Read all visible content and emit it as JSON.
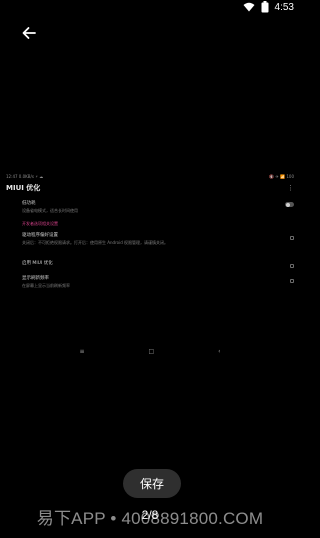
{
  "status_bar": {
    "time": "4:53",
    "icons": [
      "wifi-icon",
      "battery-icon"
    ]
  },
  "nav": {
    "back_icon": "arrow-left-icon"
  },
  "preview": {
    "status_left": "12:47 0.0KB/s ⚡ ☁",
    "status_right": "🔇 ✈ 📶 100",
    "title": "MIUI 优化",
    "menu_icon": "overflow-menu-icon",
    "rows": [
      {
        "label": "低功耗",
        "sub": "设备省电模式，适合长时间使用",
        "control": "toggle"
      },
      {
        "section": "开发者选项相关设置"
      },
      {
        "label": "驱动程序偏好设置",
        "sub": "关闭后：不可拒绝权限请求。打开后：使用原生 Android 权限管理，请谨慎关闭。",
        "control": "checkbox"
      },
      {
        "label": "启用 MIUI 优化",
        "sub": "",
        "control": "checkbox"
      },
      {
        "label": "显示刷新频率",
        "sub": "在屏幕上显示当前刷新频率",
        "control": "checkbox"
      }
    ],
    "navbar": [
      "≡",
      "□",
      "‹"
    ]
  },
  "save_button": {
    "label": "保存"
  },
  "page_indicator": "2/8",
  "watermark": "易下APP • 4008891800.COM",
  "colors": {
    "background": "#000000",
    "accent_section": "#d5428a",
    "button_bg": "#2f2f2f"
  }
}
